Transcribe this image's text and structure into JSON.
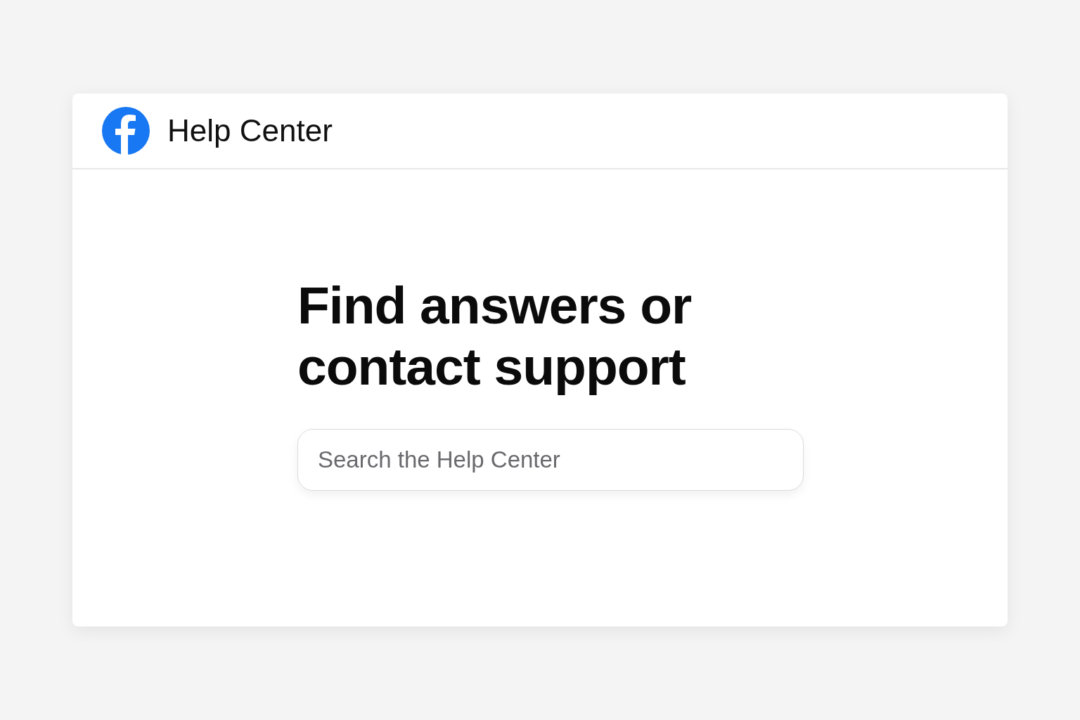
{
  "header": {
    "title": "Help Center"
  },
  "hero": {
    "heading": "Find answers or contact support"
  },
  "search": {
    "placeholder": "Search the Help Center"
  }
}
